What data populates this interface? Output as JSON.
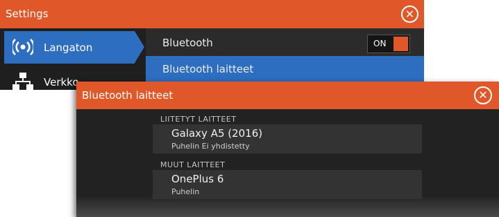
{
  "settings": {
    "title": "Settings",
    "sidebar": [
      {
        "label": "Langaton",
        "icon": "wireless-icon",
        "active": true
      },
      {
        "label": "Verkko",
        "icon": "network-icon",
        "active": false
      }
    ],
    "rows": [
      {
        "label": "Bluetooth",
        "toggle": "ON"
      },
      {
        "label": "Bluetooth laitteet"
      }
    ]
  },
  "dialog": {
    "title": "Bluetooth laitteet",
    "paired_header": "LIITETYT LAITTEET",
    "paired": [
      {
        "name": "Galaxy A5 (2016)",
        "status": "Puhelin Ei yhdistetty"
      }
    ],
    "other_header": "MUUT LAITTEET",
    "other": [
      {
        "name": "OnePlus 6",
        "status": "Puhelin"
      }
    ]
  },
  "colors": {
    "accent": "#e0582a",
    "selection": "#2d6ec0",
    "panel": "#2b2b2b"
  }
}
